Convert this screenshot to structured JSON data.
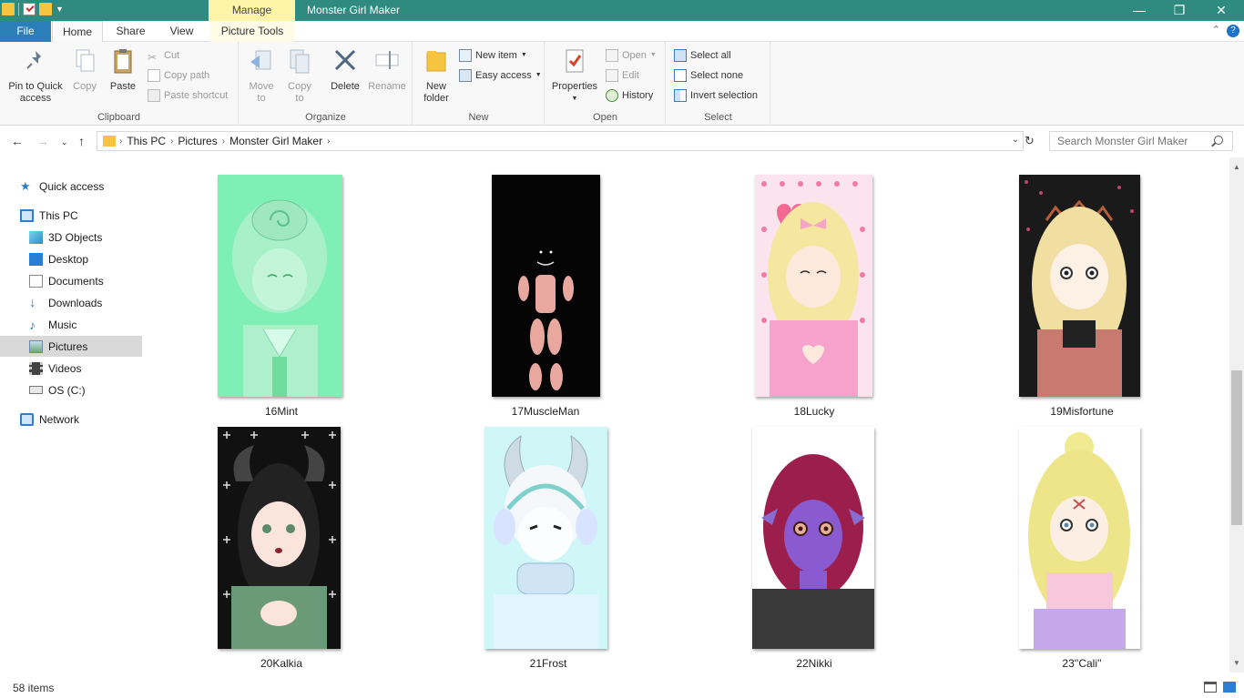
{
  "titlebar": {
    "manage_tab": "Manage",
    "window_title": "Monster Girl Maker",
    "minimize": "—",
    "restore": "❐",
    "close": "✕"
  },
  "tabs": {
    "file": "File",
    "home": "Home",
    "share": "Share",
    "view": "View",
    "picture_tools": "Picture Tools"
  },
  "ribbon": {
    "clipboard": {
      "label": "Clipboard",
      "pin": "Pin to Quick access",
      "copy": "Copy",
      "paste": "Paste",
      "cut": "Cut",
      "copy_path": "Copy path",
      "paste_shortcut": "Paste shortcut"
    },
    "organize": {
      "label": "Organize",
      "move_to": "Move to",
      "copy_to": "Copy to",
      "delete": "Delete",
      "rename": "Rename"
    },
    "new": {
      "label": "New",
      "new_folder": "New folder",
      "new_item": "New item",
      "easy_access": "Easy access"
    },
    "open": {
      "label": "Open",
      "properties": "Properties",
      "open": "Open",
      "edit": "Edit",
      "history": "History"
    },
    "select": {
      "label": "Select",
      "select_all": "Select all",
      "select_none": "Select none",
      "invert": "Invert selection"
    }
  },
  "address": {
    "crumbs": [
      "This PC",
      "Pictures",
      "Monster Girl Maker"
    ],
    "search_placeholder": "Search Monster Girl Maker"
  },
  "sidebar": {
    "items": [
      {
        "label": "Quick access",
        "icon": "star-icon"
      },
      {
        "label": "This PC",
        "icon": "computer-icon"
      },
      {
        "label": "3D Objects",
        "icon": "cube-icon"
      },
      {
        "label": "Desktop",
        "icon": "desktop-icon"
      },
      {
        "label": "Documents",
        "icon": "document-icon"
      },
      {
        "label": "Downloads",
        "icon": "download-icon"
      },
      {
        "label": "Music",
        "icon": "music-icon"
      },
      {
        "label": "Pictures",
        "icon": "pictures-icon"
      },
      {
        "label": "Videos",
        "icon": "videos-icon"
      },
      {
        "label": "OS (C:)",
        "icon": "drive-icon"
      },
      {
        "label": "Network",
        "icon": "network-icon"
      }
    ]
  },
  "files": {
    "row1": [
      "16Mint",
      "17MuscleMan",
      "18Lucky",
      "19Misfortune"
    ],
    "row2": [
      "20Kalkia",
      "21Frost",
      "22Nikki",
      "23''Cali''"
    ]
  },
  "status": {
    "item_count": "58 items"
  },
  "colors": {
    "titlebar": "#2f8a80",
    "file_tab": "#2a7fb8",
    "manage_tab": "#fff4a8",
    "selected_nav": "#d9d9d9"
  }
}
